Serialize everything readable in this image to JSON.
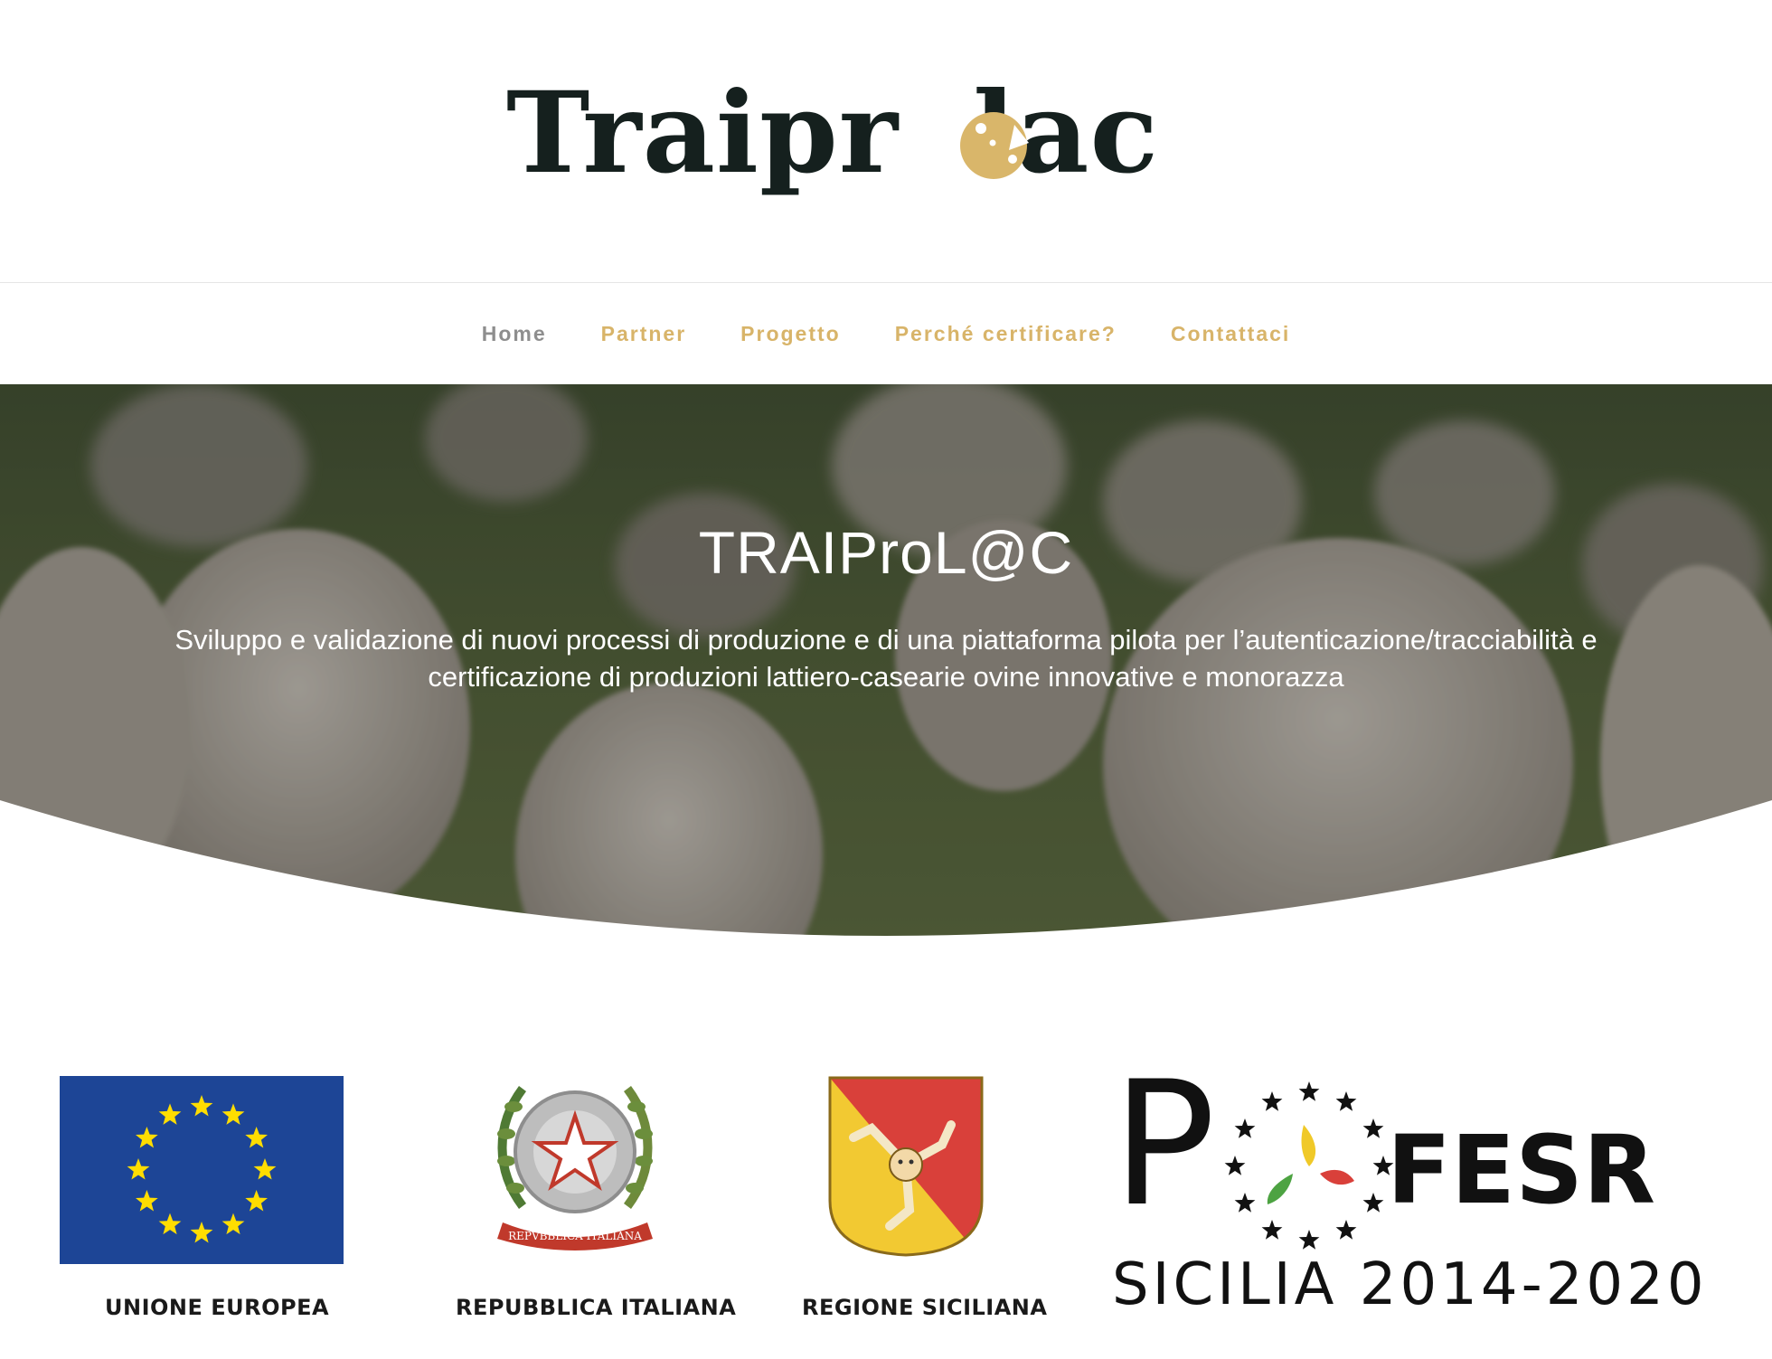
{
  "brand": {
    "logo_text_left": "Traipr",
    "logo_text_right": "lac"
  },
  "nav": {
    "items": [
      {
        "label": "Home",
        "active": true
      },
      {
        "label": "Partner",
        "active": false
      },
      {
        "label": "Progetto",
        "active": false
      },
      {
        "label": "Perché certificare?",
        "active": false
      },
      {
        "label": "Contattaci",
        "active": false
      }
    ]
  },
  "hero": {
    "title": "TRAIProL@C",
    "subtitle_line1": "Sviluppo e validazione di nuovi processi di produzione e di una piattaforma pilota per l’autenticazione/tracciabilità e",
    "subtitle_line2": "certificazione di produzioni lattiero-casearie ovine innovative e monorazza"
  },
  "funding": {
    "eu_label": "UNIONE EUROPEA",
    "it_label": "REPUBBLICA ITALIANA",
    "it_emblem_text": "REPVBBLICA ITALIANA",
    "sicily_label": "REGIONE SICILIANA",
    "po_letter": "P",
    "fesr_label": "FESR",
    "fesr_subtitle": "SICILIA 2014-2020"
  },
  "colors": {
    "accent_gold": "#d8b469",
    "nav_active": "#8e8e8e",
    "logo_dark": "#15201e",
    "eu_blue": "#1d4596",
    "eu_star": "#ffdd00",
    "sicily_red": "#d9403a",
    "sicily_yellow": "#f2c932"
  }
}
